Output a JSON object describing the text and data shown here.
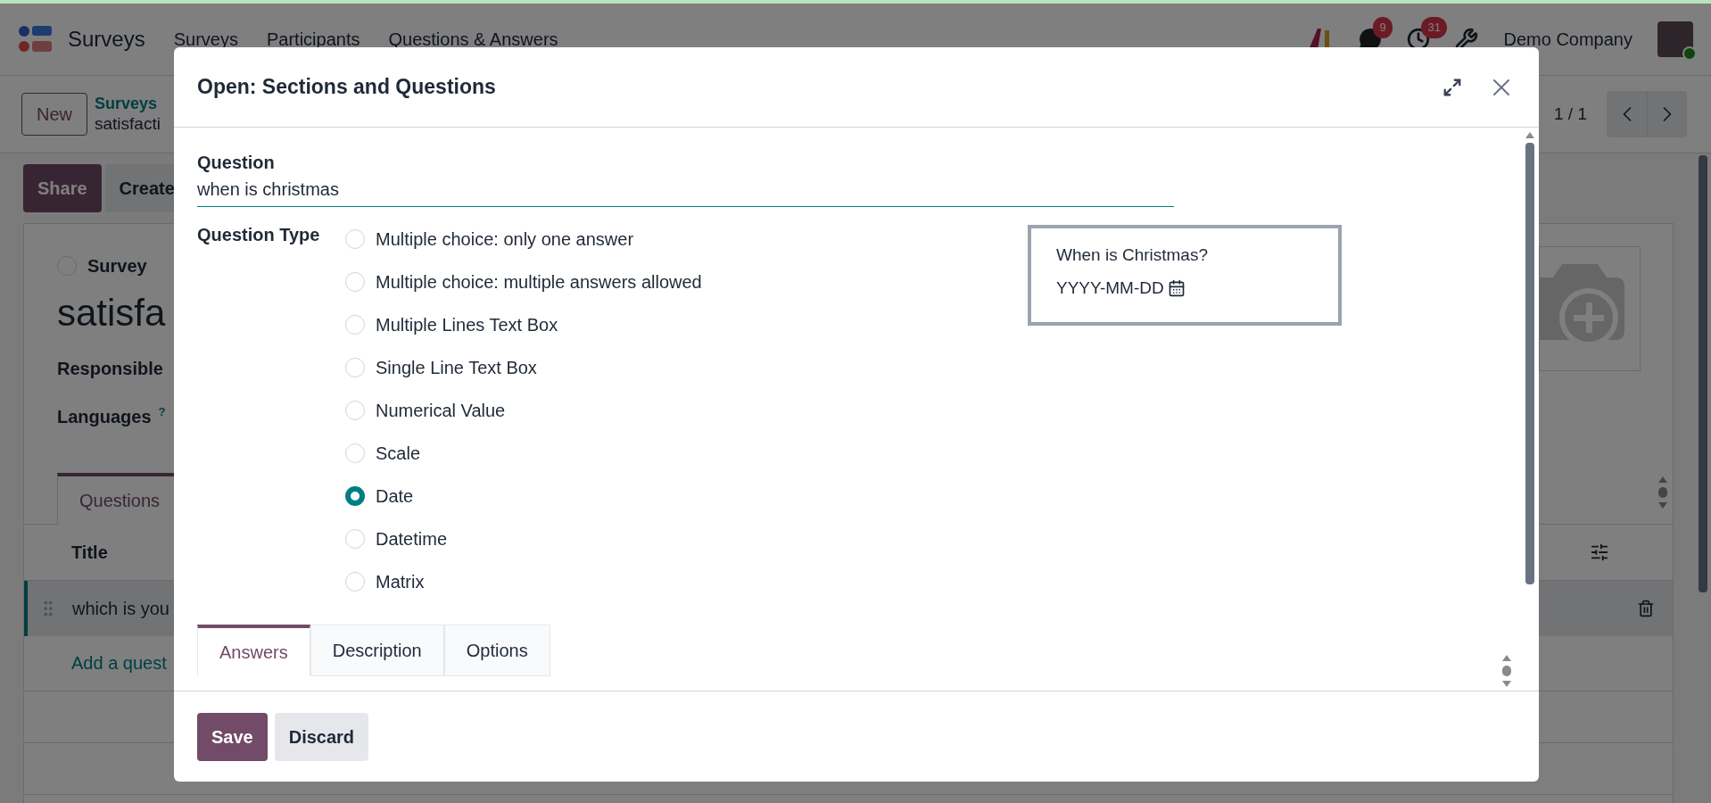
{
  "navbar": {
    "app_name": "Surveys",
    "menu": [
      "Surveys",
      "Participants",
      "Questions & Answers"
    ],
    "notifications": [
      {
        "kind": "chat",
        "count": "9"
      },
      {
        "kind": "activity",
        "count": "31"
      }
    ],
    "company": "Demo Company"
  },
  "control_panel": {
    "new_button": "New",
    "breadcrumb": [
      "Surveys",
      "satisfacti"
    ],
    "pager": "1 / 1"
  },
  "form": {
    "buttons": [
      "Share",
      "Create"
    ],
    "survey_radio": {
      "label": "Survey",
      "selected": false
    },
    "title": "satisfa",
    "fields": [
      {
        "label": "Responsible"
      },
      {
        "label": "Languages",
        "help": "?"
      }
    ],
    "tabs": [
      {
        "label": "Questions",
        "selected": true
      }
    ],
    "table": {
      "columns": [
        "Title"
      ],
      "rows": [
        {
          "title": "which is you"
        }
      ],
      "add_line": "Add a quest"
    }
  },
  "dialog": {
    "title": "Open: Sections and Questions",
    "question_label": "Question",
    "question_value": "when is christmas",
    "question_type_label": "Question Type",
    "question_types": [
      {
        "label": "Multiple choice: only one answer",
        "selected": false
      },
      {
        "label": "Multiple choice: multiple answers allowed",
        "selected": false
      },
      {
        "label": "Multiple Lines Text Box",
        "selected": false
      },
      {
        "label": "Single Line Text Box",
        "selected": false
      },
      {
        "label": "Numerical Value",
        "selected": false
      },
      {
        "label": "Scale",
        "selected": false
      },
      {
        "label": "Date",
        "selected": true
      },
      {
        "label": "Datetime",
        "selected": false
      },
      {
        "label": "Matrix",
        "selected": false
      }
    ],
    "preview": {
      "question": "When is Christmas?",
      "placeholder": "YYYY-MM-DD"
    },
    "tabs": [
      {
        "label": "Answers",
        "selected": true
      },
      {
        "label": "Description",
        "selected": false
      },
      {
        "label": "Options",
        "selected": false
      }
    ],
    "buttons": [
      "Save",
      "Discard"
    ]
  }
}
